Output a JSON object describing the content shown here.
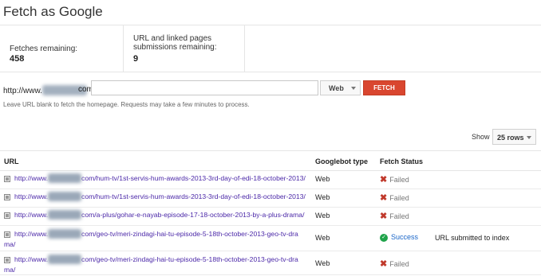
{
  "page_title": "Fetch as Google",
  "stats": {
    "fetches_label": "Fetches remaining:",
    "fetches_value": "458",
    "submissions_label_line1": "URL and linked pages",
    "submissions_label_line2": "submissions remaining:",
    "submissions_value": "9"
  },
  "fetch_form": {
    "url_prefix": "http://www.",
    "url_suffix": "com/",
    "input_value": "",
    "crawler_select": "Web",
    "fetch_button": "FETCH",
    "hint": "Leave URL blank to fetch the homepage. Requests may take a few minutes to process."
  },
  "table_controls": {
    "show_label": "Show",
    "rows_select": "25 rows"
  },
  "table": {
    "headers": {
      "url": "URL",
      "type": "Googlebot type",
      "status": "Fetch Status"
    },
    "rows": [
      {
        "url_prefix": "http://www.",
        "url_rest": "com/hum-tv/1st-servis-hum-awards-2013-3rd-day-of-edi-18-october-2013/",
        "url_rest2": "",
        "type": "Web",
        "status": "Failed",
        "status_kind": "failed",
        "note": ""
      },
      {
        "url_prefix": "http://www.",
        "url_rest": "com/hum-tv/1st-servis-hum-awards-2013-3rd-day-of-edi-18-october-2013/",
        "url_rest2": "",
        "type": "Web",
        "status": "Failed",
        "status_kind": "failed",
        "note": ""
      },
      {
        "url_prefix": "http://www.",
        "url_rest": "com/a-plus/gohar-e-nayab-episode-17-18-october-2013-by-a-plus-drama/",
        "url_rest2": "",
        "type": "Web",
        "status": "Failed",
        "status_kind": "failed",
        "note": ""
      },
      {
        "url_prefix": "http://www.",
        "url_rest": "com/geo-tv/meri-zindagi-hai-tu-episode-5-18th-october-2013-geo-tv-dra",
        "url_rest2": "ma/",
        "type": "Web",
        "status": "Success",
        "status_kind": "success",
        "note": "URL submitted to index"
      },
      {
        "url_prefix": "http://www.",
        "url_rest": "com/geo-tv/meri-zindagi-hai-tu-episode-5-18th-october-2013-geo-tv-dra",
        "url_rest2": "ma/",
        "type": "Web",
        "status": "Failed",
        "status_kind": "failed",
        "note": ""
      }
    ]
  }
}
